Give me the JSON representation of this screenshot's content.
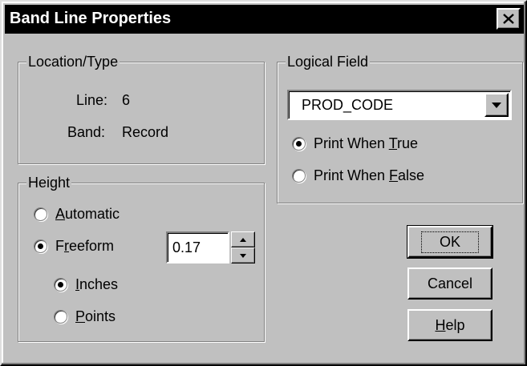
{
  "window": {
    "title": "Band Line Properties"
  },
  "location_type": {
    "legend": "Location/Type",
    "line_label": "Line:",
    "line_value": "6",
    "band_label": "Band:",
    "band_value": "Record"
  },
  "logical_field": {
    "legend": "Logical Field",
    "selected": "PROD_CODE",
    "options": [
      {
        "before": "Print When ",
        "mnemonic": "T",
        "after": "rue",
        "checked": true
      },
      {
        "before": "Print When ",
        "mnemonic": "F",
        "after": "alse",
        "checked": false
      }
    ]
  },
  "height": {
    "legend": "Height",
    "automatic": {
      "before": "",
      "mnemonic": "A",
      "after": "utomatic",
      "checked": false
    },
    "freeform": {
      "before": "F",
      "mnemonic": "r",
      "after": "eeform",
      "checked": true
    },
    "value": "0.17",
    "inches": {
      "before": "",
      "mnemonic": "I",
      "after": "nches",
      "checked": true
    },
    "points": {
      "before": "",
      "mnemonic": "P",
      "after": "oints",
      "checked": false
    }
  },
  "buttons": {
    "ok": "OK",
    "cancel": "Cancel",
    "help_mnemonic": "H",
    "help_rest": "elp"
  },
  "icons": {
    "close": "close-icon",
    "dropdown": "chevron-down-icon",
    "spin_up": "spin-up-icon",
    "spin_down": "spin-down-icon"
  }
}
